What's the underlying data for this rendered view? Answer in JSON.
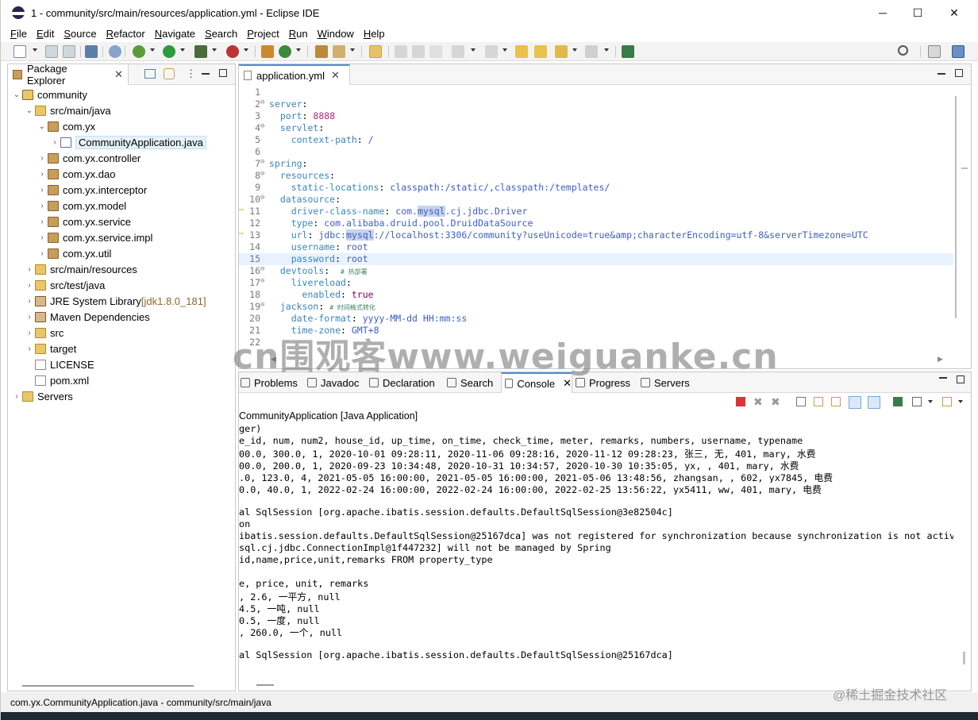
{
  "window": {
    "title": "1 - community/src/main/resources/application.yml - Eclipse IDE",
    "minimize": "─",
    "maximize": "☐",
    "close": "✕"
  },
  "menu": [
    "File",
    "Edit",
    "Source",
    "Refactor",
    "Navigate",
    "Search",
    "Project",
    "Run",
    "Window",
    "Help"
  ],
  "package_explorer": {
    "tab": "Package Explorer",
    "close": "✕",
    "items": [
      {
        "label": "community",
        "depth": 0,
        "arrow": "⌄",
        "icon": "project-icon"
      },
      {
        "label": "src/main/java",
        "depth": 1,
        "arrow": "⌄",
        "icon": "source-folder-icon"
      },
      {
        "label": "com.yx",
        "depth": 2,
        "arrow": "⌄",
        "icon": "package-icon"
      },
      {
        "label": "CommunityApplication.java",
        "depth": 3,
        "arrow": "›",
        "icon": "java-file-icon",
        "selected": true
      },
      {
        "label": "com.yx.controller",
        "depth": 2,
        "arrow": "›",
        "icon": "package-icon"
      },
      {
        "label": "com.yx.dao",
        "depth": 2,
        "arrow": "›",
        "icon": "package-icon"
      },
      {
        "label": "com.yx.interceptor",
        "depth": 2,
        "arrow": "›",
        "icon": "package-icon"
      },
      {
        "label": "com.yx.model",
        "depth": 2,
        "arrow": "›",
        "icon": "package-icon"
      },
      {
        "label": "com.yx.service",
        "depth": 2,
        "arrow": "›",
        "icon": "package-icon"
      },
      {
        "label": "com.yx.service.impl",
        "depth": 2,
        "arrow": "›",
        "icon": "package-icon"
      },
      {
        "label": "com.yx.util",
        "depth": 2,
        "arrow": "›",
        "icon": "package-icon"
      },
      {
        "label": "src/main/resources",
        "depth": 1,
        "arrow": "›",
        "icon": "source-folder-icon"
      },
      {
        "label": "src/test/java",
        "depth": 1,
        "arrow": "›",
        "icon": "source-folder-icon"
      },
      {
        "label": "JRE System Library",
        "suffix": " [jdk1.8.0_181]",
        "depth": 1,
        "arrow": "›",
        "icon": "library-icon"
      },
      {
        "label": "Maven Dependencies",
        "depth": 1,
        "arrow": "›",
        "icon": "library-icon"
      },
      {
        "label": "src",
        "depth": 1,
        "arrow": "›",
        "icon": "folder-icon"
      },
      {
        "label": "target",
        "depth": 1,
        "arrow": "›",
        "icon": "folder-icon"
      },
      {
        "label": "LICENSE",
        "depth": 1,
        "arrow": "",
        "icon": "file-icon"
      },
      {
        "label": "pom.xml",
        "depth": 1,
        "arrow": "",
        "icon": "xml-file-icon"
      },
      {
        "label": "Servers",
        "depth": 0,
        "arrow": "›",
        "icon": "folder-icon"
      }
    ]
  },
  "editor": {
    "tab": "application.yml",
    "close": "✕",
    "lines": [
      {
        "n": "1",
        "fold": "",
        "parts": []
      },
      {
        "n": "2",
        "fold": "⊖",
        "parts": [
          [
            "k",
            "server"
          ],
          [
            "",
            "："
          ]
        ]
      },
      {
        "n": "3",
        "fold": "",
        "parts": [
          [
            "",
            "  "
          ],
          [
            "k",
            "port"
          ],
          [
            "",
            ": "
          ],
          [
            "n",
            "8888"
          ]
        ]
      },
      {
        "n": "4",
        "fold": "⊖",
        "parts": [
          [
            "",
            "  "
          ],
          [
            "k",
            "servlet"
          ],
          [
            "",
            ":"
          ]
        ]
      },
      {
        "n": "5",
        "fold": "",
        "parts": [
          [
            "",
            "    "
          ],
          [
            "k",
            "context-path"
          ],
          [
            "",
            ": "
          ],
          [
            "v",
            "/"
          ]
        ]
      },
      {
        "n": "6",
        "fold": "",
        "parts": []
      },
      {
        "n": "7",
        "fold": "⊖",
        "parts": [
          [
            "k",
            "spring"
          ],
          [
            "",
            ":"
          ]
        ]
      },
      {
        "n": "8",
        "fold": "⊖",
        "parts": [
          [
            "",
            "  "
          ],
          [
            "k",
            "resources"
          ],
          [
            "",
            ":"
          ]
        ]
      },
      {
        "n": "9",
        "fold": "",
        "parts": [
          [
            "",
            "    "
          ],
          [
            "k",
            "static-locations"
          ],
          [
            "",
            ": "
          ],
          [
            "v",
            "classpath:/static/,classpath:/templates/"
          ]
        ]
      },
      {
        "n": "10",
        "fold": "⊖",
        "parts": [
          [
            "",
            "  "
          ],
          [
            "k",
            "datasource"
          ],
          [
            "",
            ":"
          ]
        ]
      },
      {
        "n": "11",
        "fold": "",
        "parts": [
          [
            "",
            "    "
          ],
          [
            "k",
            "driver-class-name"
          ],
          [
            "",
            ": "
          ],
          [
            "v",
            "com."
          ],
          [
            "vh",
            "mysql"
          ],
          [
            "v",
            ".cj.jdbc.Driver"
          ]
        ]
      },
      {
        "n": "12",
        "fold": "",
        "parts": [
          [
            "",
            "    "
          ],
          [
            "k",
            "type"
          ],
          [
            "",
            ": "
          ],
          [
            "v",
            "com.alibaba.druid.pool.DruidDataSource"
          ]
        ]
      },
      {
        "n": "13",
        "fold": "",
        "parts": [
          [
            "",
            "    "
          ],
          [
            "k",
            "url"
          ],
          [
            "",
            ": "
          ],
          [
            "v",
            "jdbc:"
          ],
          [
            "vh",
            "mysql"
          ],
          [
            "v",
            "://localhost:3306/community?useUnicode=true&amp;characterEncoding=utf-8&serverTimezone=UTC"
          ]
        ]
      },
      {
        "n": "14",
        "fold": "",
        "parts": [
          [
            "",
            "    "
          ],
          [
            "k",
            "username"
          ],
          [
            "",
            ": "
          ],
          [
            "v",
            "root"
          ]
        ]
      },
      {
        "n": "15",
        "fold": "",
        "parts": [
          [
            "",
            "    "
          ],
          [
            "k",
            "password"
          ],
          [
            "",
            ": "
          ],
          [
            "v",
            "root"
          ]
        ]
      },
      {
        "n": "16",
        "fold": "⊖",
        "parts": [
          [
            "",
            "  "
          ],
          [
            "k",
            "devtools"
          ],
          [
            "",
            ":  "
          ],
          [
            "c",
            "# 热部署"
          ]
        ]
      },
      {
        "n": "17",
        "fold": "⊖",
        "parts": [
          [
            "",
            "    "
          ],
          [
            "k",
            "livereload"
          ],
          [
            "",
            ":"
          ]
        ]
      },
      {
        "n": "18",
        "fold": "",
        "parts": [
          [
            "",
            "      "
          ],
          [
            "k",
            "enabled"
          ],
          [
            "",
            ": "
          ],
          [
            "b",
            "true"
          ]
        ]
      },
      {
        "n": "19",
        "fold": "⊖",
        "parts": [
          [
            "",
            "  "
          ],
          [
            "k",
            "jackson"
          ],
          [
            "",
            ": "
          ],
          [
            "c",
            "# 时间格式转化"
          ]
        ]
      },
      {
        "n": "20",
        "fold": "",
        "parts": [
          [
            "",
            "    "
          ],
          [
            "k",
            "date-format"
          ],
          [
            "",
            ": "
          ],
          [
            "v",
            "yyyy-MM-dd HH:mm:ss"
          ]
        ]
      },
      {
        "n": "21",
        "fold": "",
        "parts": [
          [
            "",
            "    "
          ],
          [
            "k",
            "time-zone"
          ],
          [
            "",
            ": "
          ],
          [
            "v",
            "GMT+8"
          ]
        ]
      },
      {
        "n": "22",
        "fold": "",
        "parts": []
      }
    ]
  },
  "bottom_tabs": [
    "Problems",
    "Javadoc",
    "Declaration",
    "Search",
    "Console",
    "Progress",
    "Servers"
  ],
  "console": {
    "title": "CommunityApplication [Java Application]",
    "lines": [
      "ger)",
      "e_id, num, num2, house_id, up_time, on_time, check_time, meter, remarks, numbers, username, typename",
      "00.0, 300.0, 1, 2020-10-01 09:28:11, 2020-11-06 09:28:16, 2020-11-12 09:28:23, 张三, 无, 401, mary, 水费",
      "00.0, 200.0, 1, 2020-09-23 10:34:48, 2020-10-31 10:34:57, 2020-10-30 10:35:05, yx, , 401, mary, 水费",
      ".0, 123.0, 4, 2021-05-05 16:00:00, 2021-05-05 16:00:00, 2021-05-06 13:48:56, zhangsan, , 602, yx7845, 电费",
      "0.0, 40.0, 1, 2022-02-24 16:00:00, 2022-02-24 16:00:00, 2022-02-25 13:56:22, yx5411, ww, 401, mary, 电费",
      "",
      "al SqlSession [org.apache.ibatis.session.defaults.DefaultSqlSession@3e82504c]",
      "on",
      "ibatis.session.defaults.DefaultSqlSession@25167dca] was not registered for synchronization because synchronization is not active",
      "sql.cj.jdbc.ConnectionImpl@1f447232] will not be managed by Spring",
      "id,name,price,unit,remarks FROM property_type",
      "",
      "e, price, unit, remarks",
      ", 2.6, 一平方, null",
      "4.5, 一吨, null",
      "0.5, 一度, null",
      ", 260.0, 一个, null",
      "",
      "al SqlSession [org.apache.ibatis.session.defaults.DefaultSqlSession@25167dca]"
    ]
  },
  "status": "com.yx.CommunityApplication.java - community/src/main/java",
  "watermark": "cn围观客www.weiguanke.cn",
  "juejin": "@稀土掘金技术社区",
  "colors": {
    "accent": "#0078d7",
    "key": "#3b86b9",
    "value": "#3f5fbf",
    "number": "#ad2b74"
  }
}
